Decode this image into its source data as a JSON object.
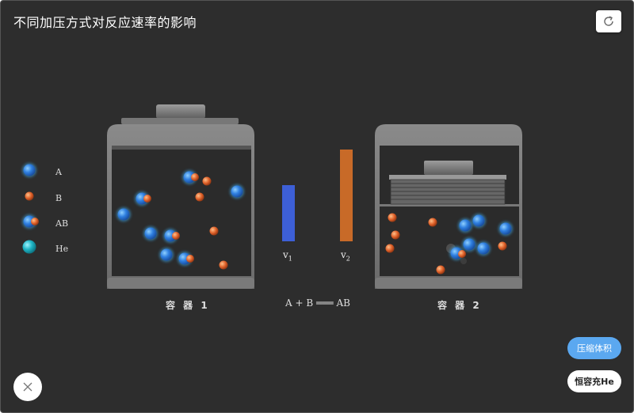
{
  "title": "不同加压方式对反应速率的影响",
  "legend": [
    {
      "label": "A"
    },
    {
      "label": "B"
    },
    {
      "label": "AB"
    },
    {
      "label": "He"
    }
  ],
  "containers": {
    "c1": "容 器 1",
    "c2": "容 器 2"
  },
  "rates": {
    "v1": "v",
    "v1_sub": "1",
    "v2": "v",
    "v2_sub": "2",
    "v1_color": "#3d5fd6",
    "v2_color": "#c86a28"
  },
  "equation": "A + B ═══ AB",
  "buttons": {
    "compress": "压缩体积",
    "add_he": "恒容充He"
  },
  "colors": {
    "A": "#2f7fe0",
    "B": "#e0622a",
    "He": "#1fb5c5",
    "accent": "#5ba8f0"
  }
}
